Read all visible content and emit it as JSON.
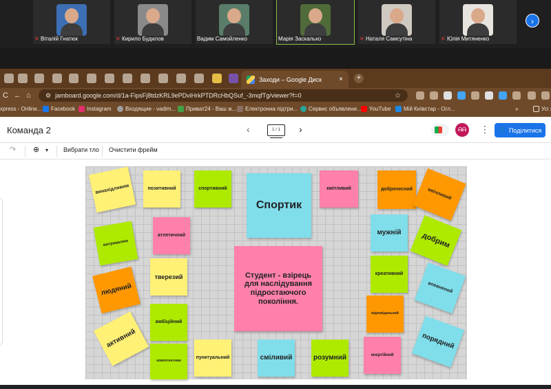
{
  "meeting": {
    "participants": [
      {
        "name": "Віталій Гнатюк",
        "muted": true
      },
      {
        "name": "Кирило Будилов",
        "muted": true
      },
      {
        "name": "Вадим Самойленко",
        "muted": false
      },
      {
        "name": "Марія Заскалько",
        "muted": false
      },
      {
        "name": "Наталя Самсутіна",
        "muted": true
      },
      {
        "name": "Юлія Митяненко",
        "muted": true
      }
    ],
    "mic_icon": "mic-off-icon",
    "next_icon": "›"
  },
  "browser": {
    "active_tab_title": "Заходи – Google Диск",
    "tab_close": "×",
    "new_tab": "+",
    "url": "jamboard.google.com/d/1a-FipsFj8tdzKRL9ePDviHrkPTDRcHbQSuf_-3mqfTg/viewer?f=0",
    "back": "←",
    "refresh": "C",
    "home": "⌂",
    "star": "☆",
    "bookmarks": [
      {
        "label": "xpress - Online...",
        "color": "#e53935"
      },
      {
        "label": "Facebook",
        "color": "#1877f2"
      },
      {
        "label": "Instagram",
        "color": "#e1306c"
      },
      {
        "label": "Входящие - vadim...",
        "color": "#9e9e9e"
      },
      {
        "label": "Приват24 - Ваш ж...",
        "color": "#43a047"
      },
      {
        "label": "Електронна підтри...",
        "color": "#8d6e63"
      },
      {
        "label": "Сервис объявлени...",
        "color": "#26a69a"
      },
      {
        "label": "YouTube",
        "color": "#ff0000"
      },
      {
        "label": "Мій Київстар - Огл...",
        "color": "#1e88e5"
      }
    ],
    "bookmarks_more": "»",
    "all_bookmarks": "Усі з"
  },
  "jamboard": {
    "title": "Команда 2",
    "frame_indicator": "1 / 1",
    "prev": "‹",
    "next": "›",
    "avatar_text": "ᕱᕱ",
    "kebab": "⋮",
    "share_label": "Поділитися",
    "toolbar": {
      "redo": "↷",
      "zoom": "⊕",
      "zoom_caret": "▾",
      "set_background": "Вибрати тло",
      "clear_frame": "Очистити фрейм"
    }
  },
  "notes": [
    {
      "id": "vynakhidlyvym",
      "text": "винахідливим",
      "color": "yellow"
    },
    {
      "id": "pozytyvnyi",
      "text": "позитивний",
      "color": "yellow"
    },
    {
      "id": "sportyvnyi",
      "text": "спортивний",
      "color": "green"
    },
    {
      "id": "sportyk",
      "text": "Спортик",
      "color": "blue"
    },
    {
      "id": "knitlyvyi",
      "text": "кмітливий",
      "color": "pink"
    },
    {
      "id": "dobrochesnyi",
      "text": "доброчесний",
      "color": "orange"
    },
    {
      "id": "vvichlyvyi",
      "text": "ввічливий",
      "color": "orange"
    },
    {
      "id": "vytryvalym",
      "text": "витривалим",
      "color": "green"
    },
    {
      "id": "atletychnyi",
      "text": "атлетичний",
      "color": "pink"
    },
    {
      "id": "muzhnii",
      "text": "мужній",
      "color": "blue"
    },
    {
      "id": "dobrym",
      "text": "добрим",
      "color": "green"
    },
    {
      "id": "tverezyi",
      "text": "тверезий",
      "color": "yellow"
    },
    {
      "id": "student",
      "text": "Студент - взірець для наслідування підростаючого покоління.",
      "color": "pink"
    },
    {
      "id": "kreatyvnyi",
      "text": "креативний",
      "color": "green"
    },
    {
      "id": "liudianyi",
      "text": "людяний",
      "color": "orange"
    },
    {
      "id": "vpevnenyi",
      "text": "впевнений",
      "color": "blue"
    },
    {
      "id": "vidpovidalnyi",
      "text": "відповідальний",
      "color": "orange"
    },
    {
      "id": "ambitsiinyi",
      "text": "амбіційний",
      "color": "green"
    },
    {
      "id": "aktyvnyi",
      "text": "активний",
      "color": "yellow"
    },
    {
      "id": "poriadnyi",
      "text": "порядний",
      "color": "blue"
    },
    {
      "id": "punktualnyi",
      "text": "пунктуальний",
      "color": "yellow"
    },
    {
      "id": "smilyvyi",
      "text": "сміливий",
      "color": "blue"
    },
    {
      "id": "rozumnyi",
      "text": "розумний",
      "color": "green"
    },
    {
      "id": "enerhiinyi",
      "text": "енергійний",
      "color": "pink"
    },
    {
      "id": "kompetentnyi",
      "text": "компетентним",
      "color": "green"
    }
  ],
  "colors": {
    "yellow": "#fff176",
    "green": "#aeea00",
    "pink": "#ff80ab",
    "orange": "#ff9800",
    "blue": "#80deea",
    "share": "#1a73e8",
    "browser_frame": "#6e4a2a"
  }
}
